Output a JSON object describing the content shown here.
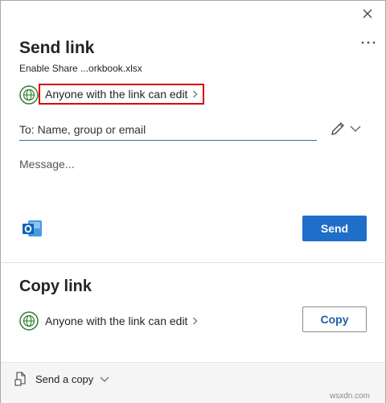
{
  "dialog": {
    "close_icon": "close-icon",
    "more_icon": "more-options-icon"
  },
  "send_link": {
    "title": "Send link",
    "filename": "Enable Share ...orkbook.xlsx",
    "permission_label": "Anyone with the link can edit",
    "to_placeholder": "To: Name, group or email",
    "message_placeholder": "Message...",
    "send_label": "Send",
    "accent_color": "#1f6ec9",
    "highlight_color": "#d8000d"
  },
  "copy_link": {
    "title": "Copy link",
    "permission_label": "Anyone with the link can edit",
    "copy_label": "Copy"
  },
  "footer": {
    "send_copy_label": "Send a copy"
  },
  "watermark": "wsxdn.com"
}
